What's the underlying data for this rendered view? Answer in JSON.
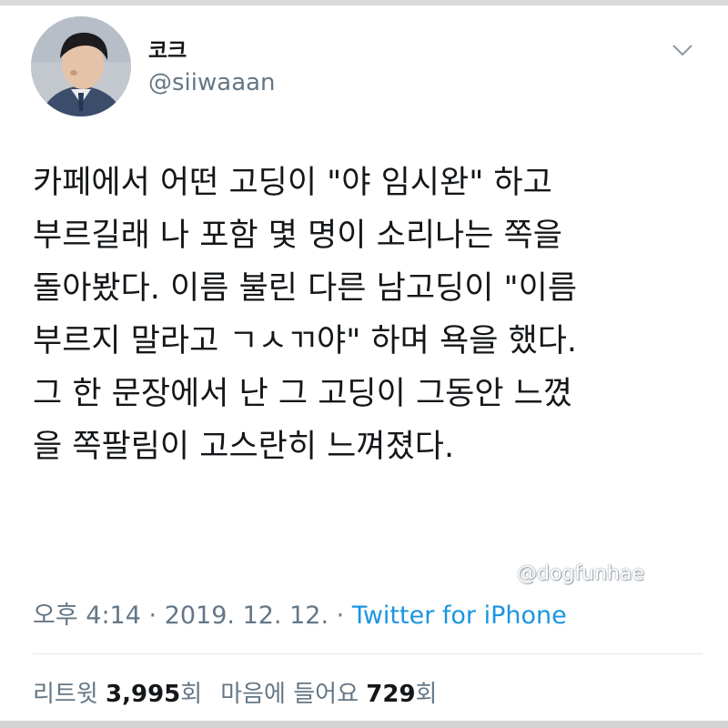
{
  "tweet": {
    "display_name": "코크",
    "handle": "@siiwaaan",
    "text_lines": [
      "카페에서 어떤 고딩이 \"야 임시완\" 하고",
      "부르길래 나 포함 몇 명이 소리나는 쪽을",
      "돌아봤다. 이름 불린 다른 남고딩이 \"이름",
      "부르지 말라고 ㄱㅅㄲ야\" 하며 욕을 했다.",
      "그 한 문장에서 난 그 고딩이 그동안 느꼈",
      "을 쪽팔림이 고스란히 느껴졌다."
    ],
    "time": "오후 4:14",
    "separator": "·",
    "date": "2019. 12. 12.",
    "source": "Twitter for iPhone"
  },
  "stats": {
    "retweets_label": "리트윗",
    "retweets_count": "3,995",
    "retweets_unit": "회",
    "likes_label": "마음에 들어요",
    "likes_count": "729",
    "likes_unit": "회"
  },
  "watermark": "@dogfunhae",
  "icons": {
    "avatar": "profile-photo",
    "menu": "chevron-down-icon"
  },
  "colors": {
    "text": "#14171a",
    "secondary": "#657786",
    "link": "#1b95e0"
  }
}
